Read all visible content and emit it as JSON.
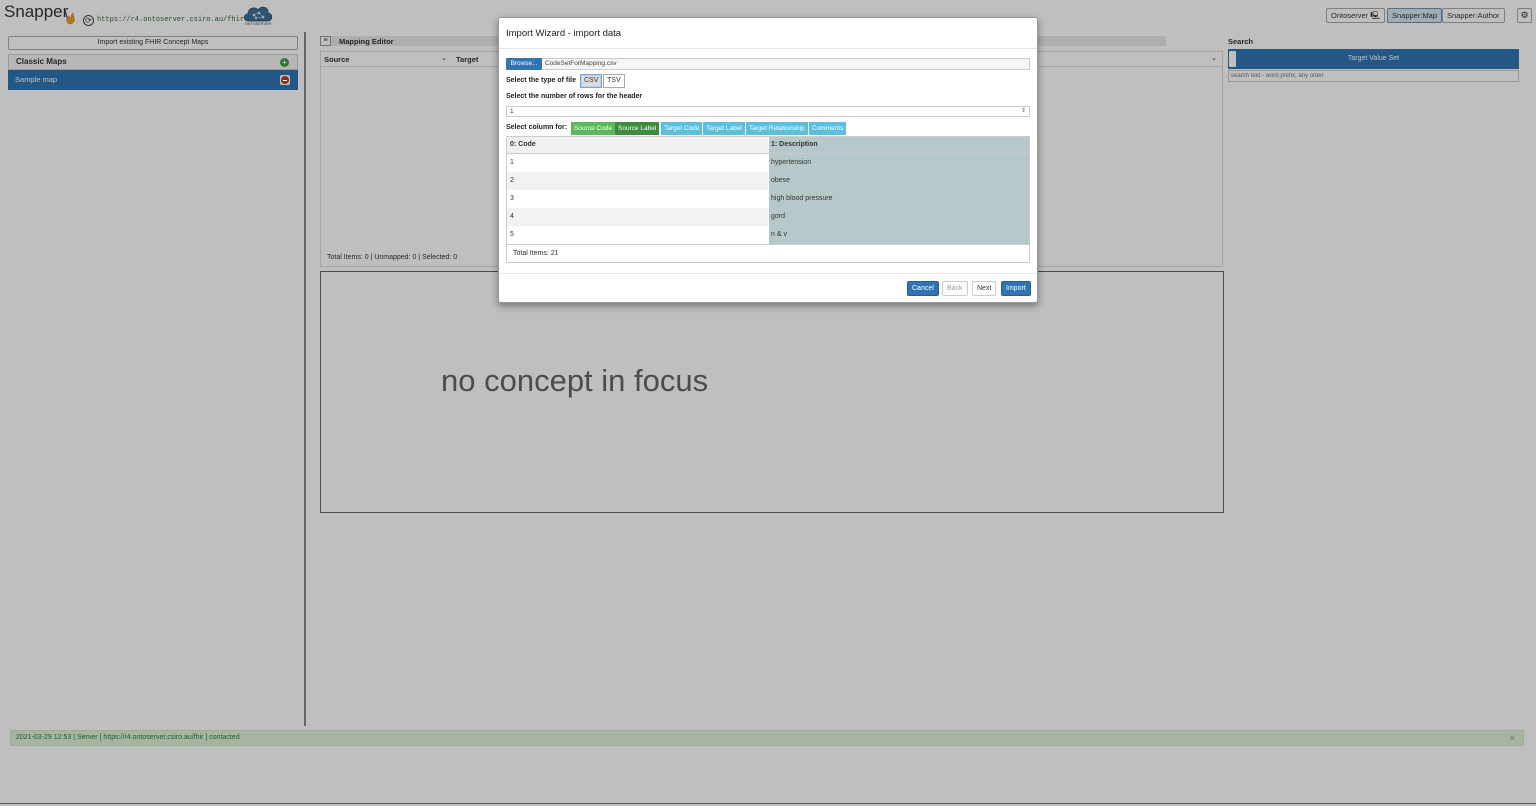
{
  "app": {
    "brand": "Snapper",
    "server_url": "https://r4.ontoserver.csiro.au/fhir",
    "cloud_caption": "ONTOSERVER",
    "top_buttons": [
      "Ontoserver",
      "Snapper:Map",
      "Snapper:Author"
    ],
    "active_button": "Snapper:Map"
  },
  "sidebar": {
    "import_button": "Import existing FHIR Concept Maps",
    "section_title": "Classic Maps",
    "items": [
      {
        "label": "Sample map"
      }
    ]
  },
  "editor": {
    "title": "Mapping Editor",
    "col_source": "Source",
    "col_target": "Target",
    "totals": "Total Items: 0 | Unmapped: 0 | Selected: 0",
    "focus_placeholder": "no concept in focus"
  },
  "search": {
    "title": "Search",
    "target_value_set": "Target Value Set",
    "placeholder": "search text - word prefix, any order"
  },
  "status": {
    "message": "2021-03-29 12:53 | Server [ https://r4.ontoserver.csiro.au/fhir ] contacted",
    "close": "×"
  },
  "modal": {
    "title": "Import Wizard - import data",
    "browse_label": "Browse...",
    "file_name": "CodeSetForMapping.csv",
    "file_type_label": "Select the type of file",
    "file_types": [
      "CSV",
      "TSV"
    ],
    "selected_file_type": "CSV",
    "header_rows_label": "Select the number of rows for the header",
    "header_rows_value": "1",
    "column_label": "Select column for:",
    "column_tags": [
      "Source Code",
      "Source Label",
      "Target Code",
      "Target Label",
      "Target Relationship",
      "Comments"
    ],
    "grid": {
      "headers": [
        "0: Code",
        "1: Description"
      ],
      "rows": [
        [
          "1",
          "hypertension"
        ],
        [
          "2",
          "obese"
        ],
        [
          "3",
          "high blood pressure"
        ],
        [
          "4",
          "gord"
        ],
        [
          "5",
          "n & v"
        ]
      ],
      "total": "Total Items: 21"
    },
    "buttons": {
      "cancel": "Cancel",
      "back": "Back",
      "next": "Next",
      "import": "Import"
    }
  },
  "colors": {
    "primary": "#2f74b3",
    "source_tag": "#5cb85c",
    "target_tag": "#5bc0de",
    "selected_column": "#b6c8c9",
    "status_bg": "#dff0d8"
  }
}
